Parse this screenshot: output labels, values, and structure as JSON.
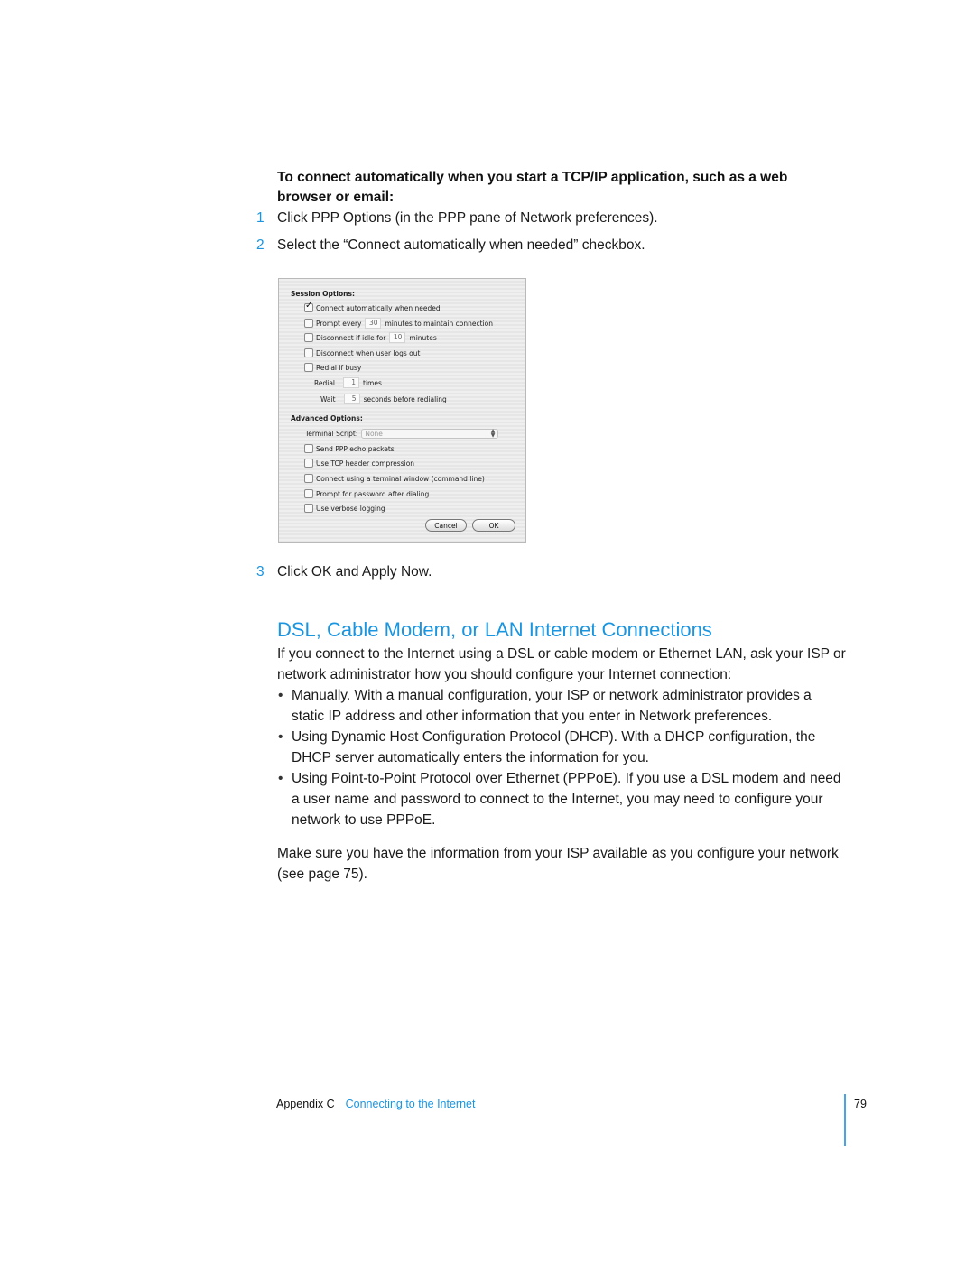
{
  "intro": {
    "lead": "To connect automatically when you start a TCP/IP application, such as a web browser or email:"
  },
  "steps": [
    {
      "num": "1",
      "text": "Click PPP Options (in the PPP pane of Network preferences)."
    },
    {
      "num": "2",
      "text": "Select the “Connect automatically when needed” checkbox."
    },
    {
      "num": "3",
      "text": "Click OK and Apply Now."
    }
  ],
  "dialog": {
    "session_heading": "Session Options:",
    "session": {
      "connect_auto": {
        "label": "Connect automatically when needed",
        "checked": true
      },
      "prompt_every": {
        "pre": "Prompt every",
        "value": "30",
        "post": "minutes to maintain connection",
        "checked": false
      },
      "disconnect_idle": {
        "pre": "Disconnect if idle for",
        "value": "10",
        "post": "minutes",
        "checked": false
      },
      "disconnect_logout": {
        "label": "Disconnect when user logs out",
        "checked": false
      },
      "redial_busy": {
        "label": "Redial if busy",
        "checked": false
      },
      "redial": {
        "pre": "Redial",
        "value": "1",
        "post": "times"
      },
      "wait": {
        "pre": "Wait",
        "value": "5",
        "post": "seconds before redialing"
      }
    },
    "advanced_heading": "Advanced Options:",
    "terminal_script": {
      "label": "Terminal Script:",
      "value": "None"
    },
    "advanced": [
      {
        "label": "Send PPP echo packets",
        "checked": false
      },
      {
        "label": "Use TCP header compression",
        "checked": false
      },
      {
        "label": "Connect using a terminal window (command line)",
        "checked": false
      },
      {
        "label": "Prompt for password after dialing",
        "checked": false
      },
      {
        "label": "Use verbose logging",
        "checked": false
      }
    ],
    "cancel_label": "Cancel",
    "ok_label": "OK"
  },
  "section": {
    "title": "DSL, Cable Modem, or LAN Internet Connections",
    "intro": "If you connect to the Internet using a DSL or cable modem or Ethernet LAN, ask your ISP or network administrator how you should configure your Internet connection:",
    "bullets": [
      "Manually. With a manual configuration, your ISP or network administrator provides a static IP address and other information that you enter in Network preferences.",
      "Using Dynamic Host Configuration Protocol (DHCP). With a DHCP configuration, the DHCP server automatically enters the information for you.",
      "Using Point-to-Point Protocol over Ethernet (PPPoE). If you use a DSL modem and need a user name and password to connect to the Internet, you may need to configure your network to use PPPoE."
    ],
    "closing": "Make sure you have the information from your ISP available as you configure your network (see page 75)."
  },
  "footer": {
    "chapter": "Appendix C",
    "chapter_title": "Connecting to the Internet",
    "page": "79"
  },
  "colors": {
    "accent": "#1a95e0"
  }
}
